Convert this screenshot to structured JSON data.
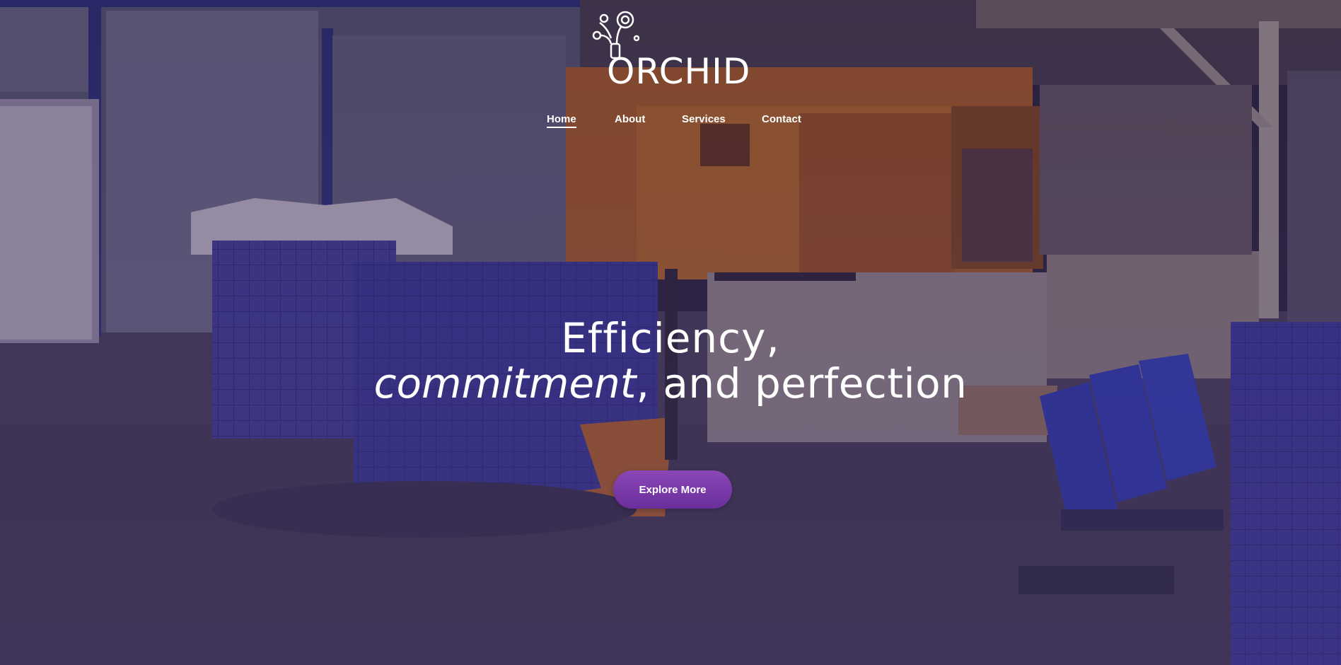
{
  "brand": {
    "name": "ORCHID"
  },
  "nav": {
    "items": [
      {
        "label": "Home",
        "active": true
      },
      {
        "label": "About",
        "active": false
      },
      {
        "label": "Services",
        "active": false
      },
      {
        "label": "Contact",
        "active": false
      }
    ]
  },
  "hero": {
    "headline_line1": "Efficiency,",
    "headline_italic": "commitment",
    "headline_rest": ", and perfection",
    "cta_label": "Explore More"
  },
  "colors": {
    "accent": "#7b3aa8",
    "overlay": "#3a2a5c",
    "text": "#ffffff"
  },
  "icons": {
    "logo": "molecule-flask-icon"
  }
}
